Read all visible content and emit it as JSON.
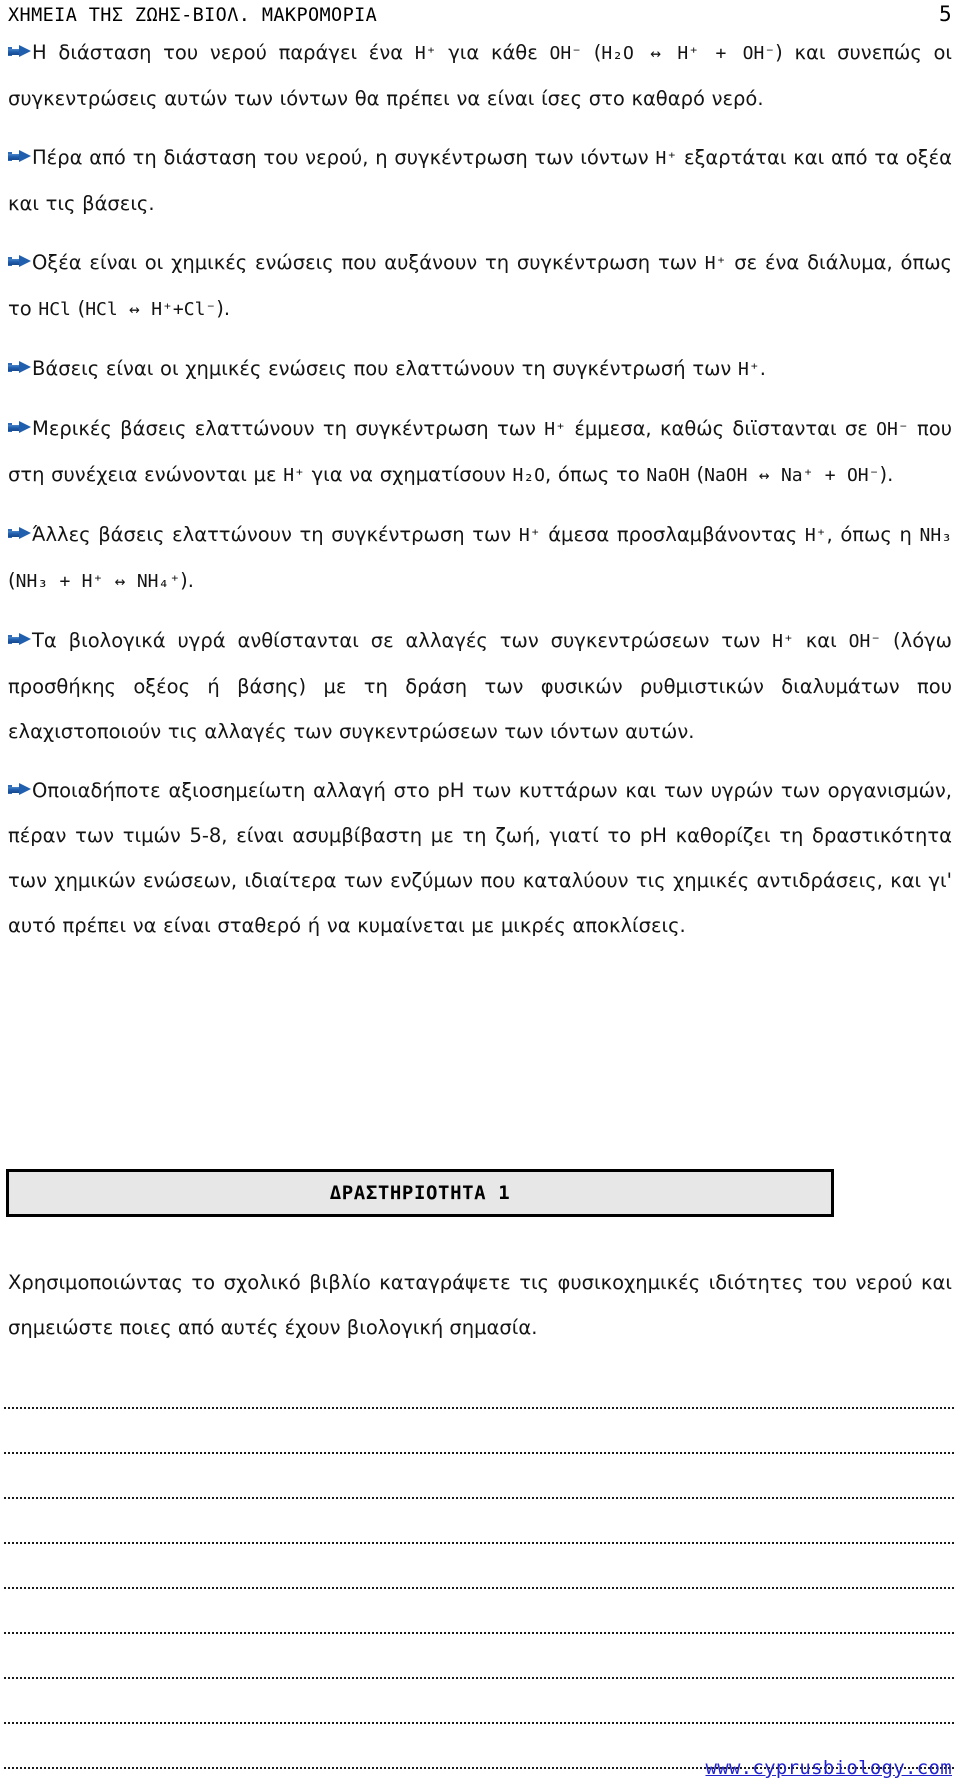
{
  "header": {
    "title": "ΧΗΜΕΙΑ ΤΗΣ ΖΩΗΣ-ΒΙΟΛ. ΜΑΚΡΟΜΟΡΙΑ",
    "page_number": "5"
  },
  "colors": {
    "bullet_blue": "#1f5fae",
    "link_blue": "#2222cc",
    "box_fill": "#e7e7e7",
    "box_border": "#000000",
    "text": "#141414"
  },
  "bullets": [
    {
      "id": "dissociation-of-water",
      "text_before": "Η διάσταση του νερού παράγει ένα ",
      "formula_1": "H⁺",
      "text_mid_1": " για κάθε ",
      "formula_2": "OH⁻",
      "text_mid_2": " (",
      "formula_3": "H₂O ↔ H⁺ + OH⁻",
      "text_after": ") και συνεπώς οι συγκεντρώσεις αυτών των ιόντων θα πρέπει να είναι ίσες στο καθαρό νερό."
    },
    {
      "id": "beyond-dissociation",
      "text_before": "Πέρα από τη διάσταση του νερού, η συγκέντρωση των ιόντων ",
      "formula_1": "H⁺",
      "text_after": " εξαρτάται και από τα οξέα και τις βάσεις."
    },
    {
      "id": "acids-definition",
      "text_before": "Οξέα είναι οι χημικές ενώσεις που αυξάνουν τη συγκέντρωση των ",
      "formula_1": "H⁺",
      "text_mid_1": " σε ένα διάλυμα, όπως το ",
      "formula_2": "HCl",
      "text_mid_2": " (",
      "formula_3": "HCl ↔ H⁺+Cl⁻",
      "text_after": ")."
    },
    {
      "id": "bases-definition",
      "text_before": "Βάσεις είναι οι χημικές ενώσεις που ελαττώνουν τη συγκέντρωσή των ",
      "formula_1": "H⁺",
      "text_after": "."
    },
    {
      "id": "indirect-bases",
      "text_before": "Μερικές βάσεις ελαττώνουν τη συγκέντρωση των ",
      "formula_1": "H⁺",
      "text_mid_1": " έμμεσα, καθώς διϊστανται σε ",
      "formula_2": "OH⁻",
      "text_mid_2": " που στη συνέχεια ενώνονται με ",
      "formula_3": "H⁺",
      "text_mid_3": " για να σχηματίσουν ",
      "formula_4": "H₂O",
      "text_mid_4": ", όπως το ",
      "formula_5": "NaOH",
      "text_mid_5": " (",
      "formula_6": "NaOH ↔ Na⁺ + OH⁻",
      "text_after": ")."
    },
    {
      "id": "direct-bases",
      "text_before": "Άλλες βάσεις ελαττώνουν τη συγκέντρωση των ",
      "formula_1": "H⁺",
      "text_mid_1": " άμεσα προσλαμβάνοντας ",
      "formula_2": "H⁺",
      "text_mid_2": ", όπως η ",
      "formula_3": "NH₃",
      "text_mid_3": " (",
      "formula_4": "NH₃ + H⁺ ↔ NH₄⁺",
      "text_after": ")."
    },
    {
      "id": "biological-fluids-buffers",
      "text_before": "Τα βιολογικά υγρά ανθίστανται σε αλλαγές των συγκεντρώσεων των ",
      "formula_1": "H⁺",
      "text_mid_1": " και ",
      "formula_2": "OH⁻",
      "text_after": " (λόγω προσθήκης οξέος ή βάσης) με τη δράση των φυσικών ρυθμιστικών διαλυμάτων που ελαχιστοποιούν τις αλλαγές των συγκεντρώσεων των ιόντων αυτών."
    },
    {
      "id": "ph-range-importance",
      "text_before": "Οποιαδήποτε αξιοσημείωτη αλλαγή στο pH των κυττάρων και των υγρών των οργανισμών, πέραν των τιμών 5-8, είναι ασυμβίβαστη με τη ζωή, γιατί το pH καθορίζει τη δραστικότητα των χημικών ενώσεων, ιδιαίτερα των ενζύμων που καταλύουν τις χημικές αντιδράσεις, και γι' αυτό πρέπει να είναι σταθερό ή να κυμαίνεται με μικρές αποκλίσεις.",
      "text_after": ""
    }
  ],
  "activity": {
    "title": "ΔΡΑΣΤΗΡΙΟΤΗΤΑ 1",
    "instructions": "Χρησιμοποιώντας το σχολικό βιβλίο καταγράψετε τις φυσικοχημικές ιδιότητες του νερού και σημειώστε ποιες από αυτές έχουν βιολογική σημασία.",
    "answer_line_count": 9
  },
  "footer": {
    "link_text": "www.cyprusbiology.com"
  }
}
